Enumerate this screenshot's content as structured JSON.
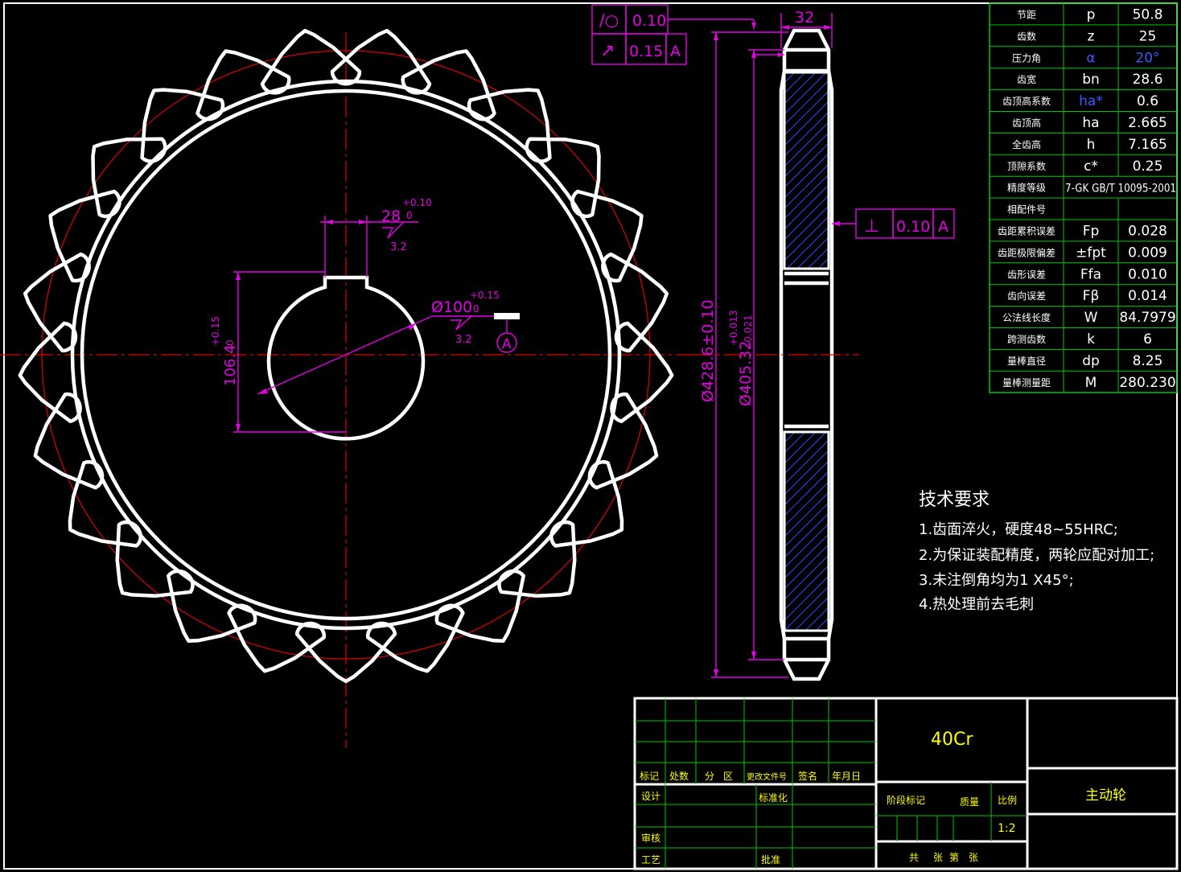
{
  "colors": {
    "outline": "#ffffff",
    "center": "#e00000",
    "dimension": "#e600e6",
    "table": "#00c800",
    "title": "#ffff00",
    "hatch": "#3344ff"
  },
  "tolerance_frames": {
    "roundness_symbol": "/○",
    "roundness_value": "0.10",
    "runout_symbol": "↗",
    "runout_value": "0.15",
    "runout_datum": "A",
    "perp_symbol": "⊥",
    "perp_value": "0.10",
    "perp_datum": "A"
  },
  "dimensions": {
    "face_width": "32",
    "keyway_width": "28",
    "keyway_upper": "+0.10",
    "keyway_lower": "0",
    "roughness_key": "3.2",
    "bore": "Ø100",
    "bore_upper": "+0.15",
    "bore_lower": "0",
    "roughness_bore": "3.2",
    "key_depth": "106.4",
    "key_depth_upper": "+0.15",
    "key_depth_lower": "0",
    "datum": "A",
    "tip_diameter": "Ø428.6±0.10",
    "root_diameter": "Ø405.32",
    "root_upper": "+0.013",
    "root_lower": "-0.021"
  },
  "params": [
    {
      "name": "节距",
      "sym": "p",
      "val": "50.8"
    },
    {
      "name": "齿数",
      "sym": "z",
      "val": "25"
    },
    {
      "name": "压力角",
      "sym": "α",
      "val": "20°",
      "blue": true
    },
    {
      "name": "齿宽",
      "sym": "bn",
      "val": "28.6"
    },
    {
      "name": "齿顶高系数",
      "sym": "ha*",
      "val": "0.6",
      "blue_sym": true
    },
    {
      "name": "齿顶高",
      "sym": "ha",
      "val": "2.665"
    },
    {
      "name": "全齿高",
      "sym": "h",
      "val": "7.165"
    },
    {
      "name": "顶隙系数",
      "sym": "c*",
      "val": "0.25"
    },
    {
      "name": "精度等级",
      "span": "7-GK GB/T 10095-2001"
    },
    {
      "name": "相配件号",
      "sym": "",
      "val": ""
    },
    {
      "name": "齿距累积误差",
      "sym": "Fp",
      "val": "0.028"
    },
    {
      "name": "齿距极限偏差",
      "sym": "±fpt",
      "val": "0.009"
    },
    {
      "name": "齿形误差",
      "sym": "Ffa",
      "val": "0.010"
    },
    {
      "name": "齿向误差",
      "sym": "Fβ",
      "val": "0.014"
    },
    {
      "name": "公法线长度",
      "sym": "W",
      "val": "84.7979"
    },
    {
      "name": "跨测齿数",
      "sym": "k",
      "val": "6"
    },
    {
      "name": "量棒直径",
      "sym": "dp",
      "val": "8.25"
    },
    {
      "name": "量棒测量距",
      "sym": "M",
      "val": "280.230"
    }
  ],
  "notes": {
    "title": "技术要求",
    "lines": [
      "1.齿面淬火，硬度48~55HRC;",
      "2.为保证装配精度，两轮应配对加工;",
      "3.未注倒角均为1 X45°;",
      "4.热处理前去毛刺"
    ]
  },
  "title_block": {
    "material": "40Cr",
    "part_name": "主动轮",
    "scale": "1:2",
    "row_labels": [
      "标记",
      "处数",
      "分",
      "区",
      "更改文件号",
      "签名",
      "年月日"
    ],
    "design": "设计",
    "standard": "标准化",
    "review": "审核",
    "process": "工艺",
    "approve": "批准",
    "stage_mark": "阶段标记",
    "weight": "质量",
    "scale_label": "比例",
    "sheets": "共",
    "sheets2": "张",
    "sheet_no": "第",
    "sheet_no2": "张"
  }
}
